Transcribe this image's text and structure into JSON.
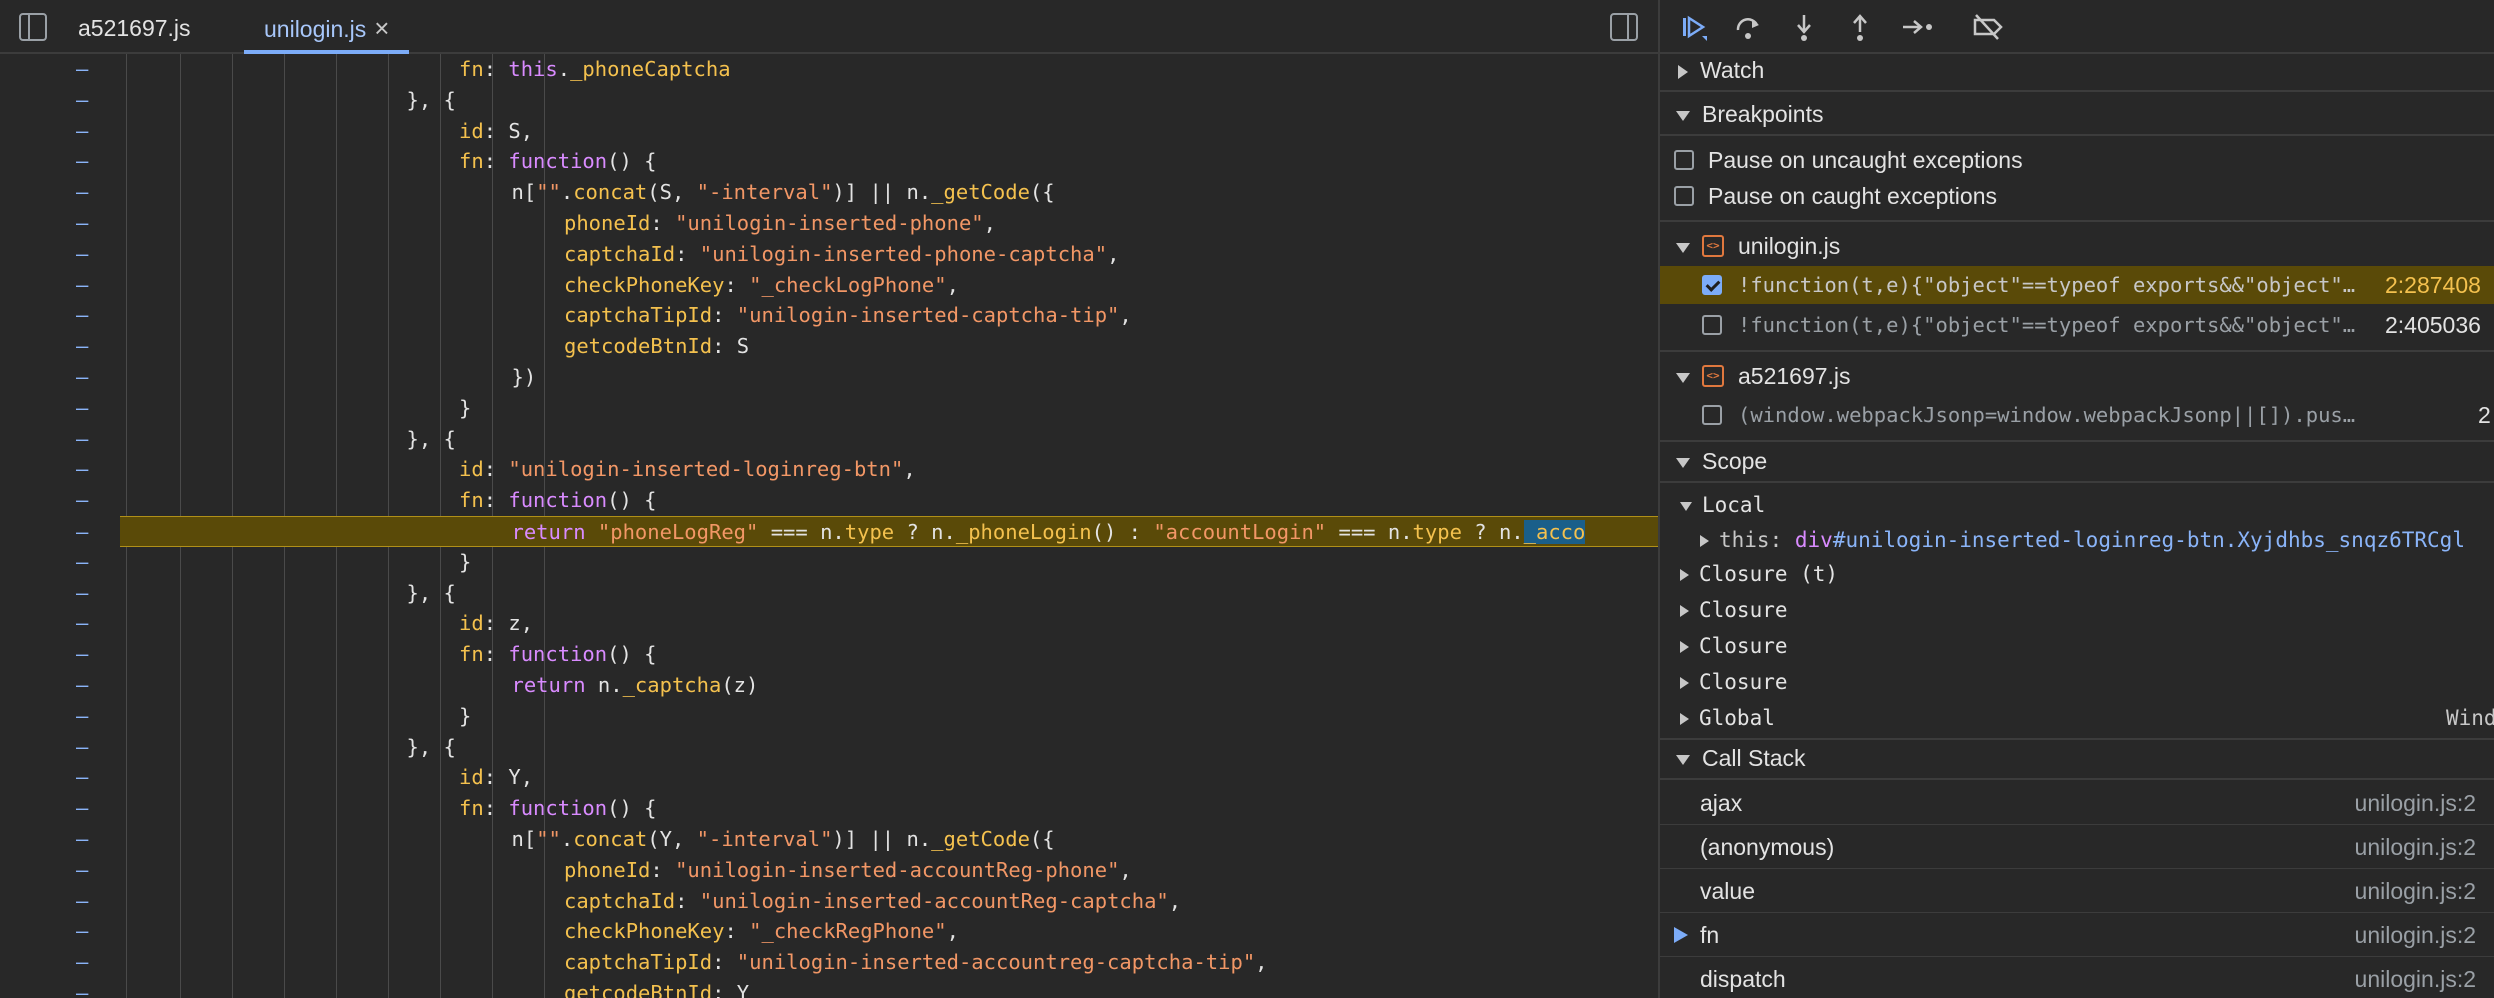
{
  "tabs": [
    {
      "label": "a521697.js"
    },
    {
      "label": "unilogin.js",
      "close": "×"
    }
  ],
  "code_lines": [
    {
      "indent": 8,
      "tokens": [
        [
          "k",
          "fn"
        ],
        [
          "p",
          ": "
        ],
        [
          "kw",
          "this"
        ],
        [
          "p",
          "."
        ],
        [
          "k",
          "_phoneCaptcha"
        ]
      ]
    },
    {
      "indent": 7,
      "tokens": [
        [
          "p",
          "}, {"
        ]
      ]
    },
    {
      "indent": 8,
      "tokens": [
        [
          "k",
          "id"
        ],
        [
          "p",
          ": S,"
        ]
      ]
    },
    {
      "indent": 8,
      "tokens": [
        [
          "k",
          "fn"
        ],
        [
          "p",
          ": "
        ],
        [
          "kw",
          "function"
        ],
        [
          "p",
          "() {"
        ]
      ]
    },
    {
      "indent": 9,
      "tokens": [
        [
          "p",
          "n["
        ],
        [
          "s",
          "\"\""
        ],
        [
          "p",
          "."
        ],
        [
          "k",
          "concat"
        ],
        [
          "p",
          "(S, "
        ],
        [
          "s",
          "\"-interval\""
        ],
        [
          "p",
          ")] || n."
        ],
        [
          "k",
          "_getCode"
        ],
        [
          "p",
          "({"
        ]
      ]
    },
    {
      "indent": 10,
      "tokens": [
        [
          "k",
          "phoneId"
        ],
        [
          "p",
          ": "
        ],
        [
          "s",
          "\"unilogin-inserted-phone\""
        ],
        [
          "p",
          ","
        ]
      ]
    },
    {
      "indent": 10,
      "tokens": [
        [
          "k",
          "captchaId"
        ],
        [
          "p",
          ": "
        ],
        [
          "s",
          "\"unilogin-inserted-phone-captcha\""
        ],
        [
          "p",
          ","
        ]
      ]
    },
    {
      "indent": 10,
      "tokens": [
        [
          "k",
          "checkPhoneKey"
        ],
        [
          "p",
          ": "
        ],
        [
          "s",
          "\"_checkLogPhone\""
        ],
        [
          "p",
          ","
        ]
      ]
    },
    {
      "indent": 10,
      "tokens": [
        [
          "k",
          "captchaTipId"
        ],
        [
          "p",
          ": "
        ],
        [
          "s",
          "\"unilogin-inserted-captcha-tip\""
        ],
        [
          "p",
          ","
        ]
      ]
    },
    {
      "indent": 10,
      "tokens": [
        [
          "k",
          "getcodeBtnId"
        ],
        [
          "p",
          ": S"
        ]
      ]
    },
    {
      "indent": 9,
      "tokens": [
        [
          "p",
          "})"
        ]
      ]
    },
    {
      "indent": 8,
      "tokens": [
        [
          "p",
          "}"
        ]
      ]
    },
    {
      "indent": 7,
      "tokens": [
        [
          "p",
          "}, {"
        ]
      ]
    },
    {
      "indent": 8,
      "tokens": [
        [
          "k",
          "id"
        ],
        [
          "p",
          ": "
        ],
        [
          "s",
          "\"unilogin-inserted-loginreg-btn\""
        ],
        [
          "p",
          ","
        ]
      ]
    },
    {
      "indent": 8,
      "tokens": [
        [
          "k",
          "fn"
        ],
        [
          "p",
          ": "
        ],
        [
          "kw",
          "function"
        ],
        [
          "p",
          "() {"
        ]
      ]
    },
    {
      "indent": 9,
      "highlight": true,
      "tokens": [
        [
          "kw",
          "return "
        ],
        [
          "s",
          "\"phoneLogReg\""
        ],
        [
          "p",
          " === n."
        ],
        [
          "k",
          "type"
        ],
        [
          "p",
          " ? n."
        ],
        [
          "k",
          "_phoneLogin"
        ],
        [
          "p",
          "() : "
        ],
        [
          "s",
          "\"accountLogin\""
        ],
        [
          "p",
          " === n."
        ],
        [
          "k",
          "type"
        ],
        [
          "p",
          " ? n."
        ],
        [
          "sel",
          "_acco"
        ]
      ]
    },
    {
      "indent": 8,
      "tokens": [
        [
          "p",
          "}"
        ]
      ]
    },
    {
      "indent": 7,
      "tokens": [
        [
          "p",
          "}, {"
        ]
      ]
    },
    {
      "indent": 8,
      "tokens": [
        [
          "k",
          "id"
        ],
        [
          "p",
          ": z,"
        ]
      ]
    },
    {
      "indent": 8,
      "tokens": [
        [
          "k",
          "fn"
        ],
        [
          "p",
          ": "
        ],
        [
          "kw",
          "function"
        ],
        [
          "p",
          "() {"
        ]
      ]
    },
    {
      "indent": 9,
      "tokens": [
        [
          "kw",
          "return "
        ],
        [
          "p",
          "n."
        ],
        [
          "k",
          "_captcha"
        ],
        [
          "p",
          "(z)"
        ]
      ]
    },
    {
      "indent": 8,
      "tokens": [
        [
          "p",
          "}"
        ]
      ]
    },
    {
      "indent": 7,
      "tokens": [
        [
          "p",
          "}, {"
        ]
      ]
    },
    {
      "indent": 8,
      "tokens": [
        [
          "k",
          "id"
        ],
        [
          "p",
          ": Y,"
        ]
      ]
    },
    {
      "indent": 8,
      "tokens": [
        [
          "k",
          "fn"
        ],
        [
          "p",
          ": "
        ],
        [
          "kw",
          "function"
        ],
        [
          "p",
          "() {"
        ]
      ]
    },
    {
      "indent": 9,
      "tokens": [
        [
          "p",
          "n["
        ],
        [
          "s",
          "\"\""
        ],
        [
          "p",
          "."
        ],
        [
          "k",
          "concat"
        ],
        [
          "p",
          "(Y, "
        ],
        [
          "s",
          "\"-interval\""
        ],
        [
          "p",
          ")] || n."
        ],
        [
          "k",
          "_getCode"
        ],
        [
          "p",
          "({"
        ]
      ]
    },
    {
      "indent": 10,
      "tokens": [
        [
          "k",
          "phoneId"
        ],
        [
          "p",
          ": "
        ],
        [
          "s",
          "\"unilogin-inserted-accountReg-phone\""
        ],
        [
          "p",
          ","
        ]
      ]
    },
    {
      "indent": 10,
      "tokens": [
        [
          "k",
          "captchaId"
        ],
        [
          "p",
          ": "
        ],
        [
          "s",
          "\"unilogin-inserted-accountReg-captcha\""
        ],
        [
          "p",
          ","
        ]
      ]
    },
    {
      "indent": 10,
      "tokens": [
        [
          "k",
          "checkPhoneKey"
        ],
        [
          "p",
          ": "
        ],
        [
          "s",
          "\"_checkRegPhone\""
        ],
        [
          "p",
          ","
        ]
      ]
    },
    {
      "indent": 10,
      "tokens": [
        [
          "k",
          "captchaTipId"
        ],
        [
          "p",
          ": "
        ],
        [
          "s",
          "\"unilogin-inserted-accountreg-captcha-tip\""
        ],
        [
          "p",
          ","
        ]
      ]
    },
    {
      "indent": 10,
      "tokens": [
        [
          "k",
          "getcodeBtnId"
        ],
        [
          "p",
          ": Y"
        ]
      ]
    }
  ],
  "gutter_mark": "–",
  "sections": {
    "watch": "Watch",
    "breakpoints": "Breakpoints",
    "scope": "Scope",
    "callstack": "Call Stack"
  },
  "exceptions": [
    {
      "label": "Pause on uncaught exceptions",
      "checked": false
    },
    {
      "label": "Pause on caught exceptions",
      "checked": false
    }
  ],
  "bp_files": [
    {
      "name": "unilogin.js",
      "items": [
        {
          "code": "!function(t,e){\"object\"==typeof exports&&\"object\"==typeof module",
          "loc": "2:287408",
          "checked": true,
          "active": true
        },
        {
          "code": "!function(t,e){\"object\"==typeof exports&&\"object\"==typeof module",
          "loc": "2:405036",
          "checked": false,
          "active": false
        }
      ]
    },
    {
      "name": "a521697.js",
      "items": [
        {
          "code": "(window.webpackJsonp=window.webpackJsonp||[]).push([[",
          "loc": "2",
          "checked": false,
          "active": false
        }
      ]
    }
  ],
  "scope": {
    "local": "Local",
    "this_key": "this",
    "this_value_tag": "div",
    "this_value_rest": "#unilogin-inserted-loginreg-btn.Xyjdhbs_snqz6TRCgl",
    "closures": [
      "Closure (t)",
      "Closure",
      "Closure",
      "Closure"
    ],
    "global": "Global",
    "global_value": "Window"
  },
  "callstack": [
    {
      "fn": "ajax",
      "where": "unilogin.js:2",
      "current": false
    },
    {
      "fn": "(anonymous)",
      "where": "unilogin.js:2",
      "current": false
    },
    {
      "fn": "value",
      "where": "unilogin.js:2",
      "current": false
    },
    {
      "fn": "fn",
      "where": "unilogin.js:2",
      "current": true
    },
    {
      "fn": "dispatch",
      "where": "unilogin.js:2",
      "current": false
    }
  ],
  "toolbar_icons": [
    "resume-icon",
    "step-over-icon",
    "step-into-icon",
    "step-out-icon",
    "step-icon",
    "deactivate-breakpoints-icon"
  ],
  "colors": {
    "accent": "#7cacf8",
    "highlight": "#5a4a08",
    "string": "#f29766",
    "keyword": "#d98bff",
    "property": "#f4c14e"
  }
}
